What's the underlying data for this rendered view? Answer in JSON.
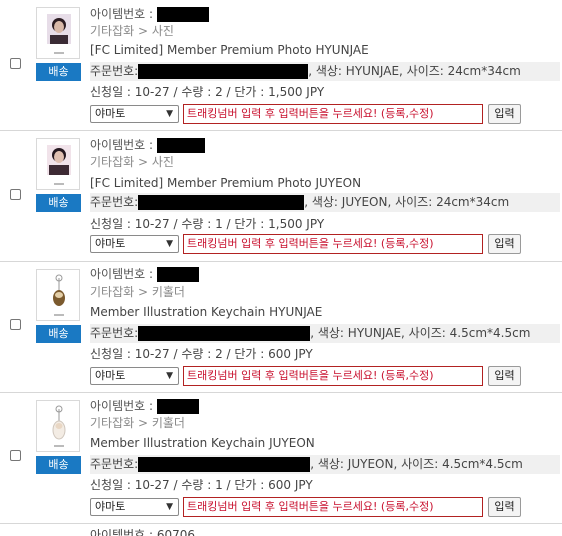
{
  "labels": {
    "item_no": "아이템번호 :",
    "order_no": "주문번호:",
    "color_prefix": ", 색상: ",
    "size_prefix": ", 사이즈: "
  },
  "rows": [
    {
      "category": "기타잡화 > 사진",
      "title": "[FC Limited] Member Premium Photo HYUNJAE",
      "badge": "배송",
      "color": "HYUNJAE",
      "size": "24cm*34cm",
      "details": "신청일 : 10-27 / 수량 : 2 / 단가 : 1,500 JPY",
      "carrier": "야마토",
      "tracking_placeholder": "트래킹넘버 입력 후 입력버튼을 누르세요! (등록,수정)",
      "submit": "입력"
    },
    {
      "category": "기타잡화 > 사진",
      "title": "[FC Limited] Member Premium Photo JUYEON",
      "badge": "배송",
      "color": "JUYEON",
      "size": "24cm*34cm",
      "details": "신청일 : 10-27 / 수량 : 1 / 단가 : 1,500 JPY",
      "carrier": "야마토",
      "tracking_placeholder": "트래킹넘버 입력 후 입력버튼을 누르세요! (등록,수정)",
      "submit": "입력"
    },
    {
      "category": "기타잡화 > 키홀더",
      "title": "Member Illustration Keychain HYUNJAE",
      "badge": "배송",
      "color": "HYUNJAE",
      "size": "4.5cm*4.5cm",
      "details": "신청일 : 10-27 / 수량 : 2 / 단가 : 600 JPY",
      "carrier": "야마토",
      "tracking_placeholder": "트래킹넘버 입력 후 입력버튼을 누르세요! (등록,수정)",
      "submit": "입력"
    },
    {
      "category": "기타잡화 > 키홀더",
      "title": "Member Illustration Keychain JUYEON",
      "badge": "배송",
      "color": "JUYEON",
      "size": "4.5cm*4.5cm",
      "details": "신청일 : 10-27 / 수량 : 1 / 단가 : 600 JPY",
      "carrier": "야마토",
      "tracking_placeholder": "트래킹넘버 입력 후 입력버튼을 누르세요! (등록,수정)",
      "submit": "입력"
    }
  ],
  "partial_next_row": {
    "item_no_text": "아이템번호 : 60706"
  },
  "colors": {
    "badge_bg": "#1a79c3",
    "tracking_border": "#b22222",
    "tracking_text": "#c8102e",
    "row_divider": "#d7d7d7",
    "order_line_bg": "#f0f0f0",
    "redaction": "#000000"
  },
  "icons": {
    "checkbox": "checkbox-icon",
    "dropdown": "chevron-down-icon"
  }
}
